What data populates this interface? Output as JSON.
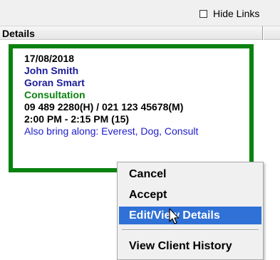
{
  "toolbar": {
    "hide_links_label": "Hide Links",
    "hide_links_checked": false
  },
  "header": {
    "title": "Details"
  },
  "appointment": {
    "date": "17/08/2018",
    "client": "John Smith",
    "provider": "Goran Smart",
    "type": "Consultation",
    "phones": "09 489 2280(H) / 021 123 45678(M)",
    "time": "2:00 PM - 2:15 PM (15)",
    "note": "Also bring along: Everest, Dog, Consult",
    "border_color": "#0a8210"
  },
  "context_menu": {
    "items": [
      {
        "label": "Cancel",
        "selected": false
      },
      {
        "label": "Accept",
        "selected": false
      },
      {
        "label": "Edit/View Details",
        "selected": true
      },
      {
        "label": "View Client History",
        "selected": false
      }
    ],
    "highlight_color": "#2f71d7"
  }
}
